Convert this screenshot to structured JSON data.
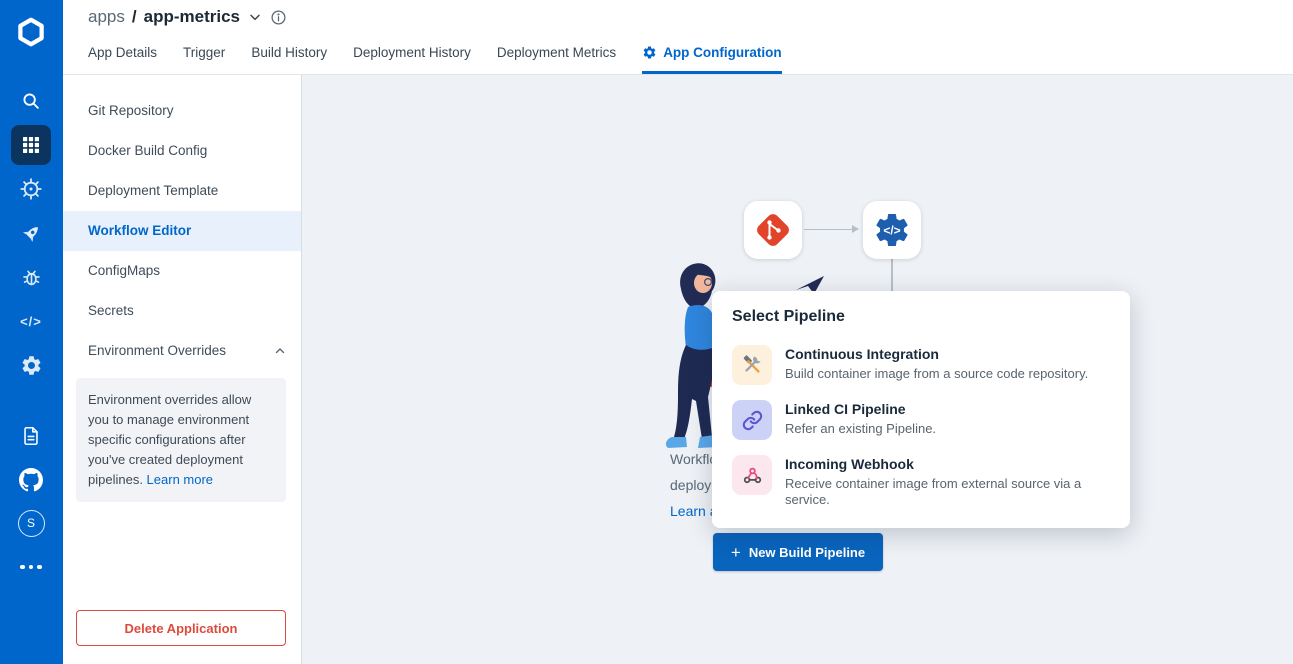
{
  "colors": {
    "accent": "#0066cc",
    "sidebar_bg": "#0066cc",
    "active_icon_bg": "#0b355e",
    "danger": "#dd4b3d",
    "link": "#0066cc",
    "ci_icon_bg": "#fdf0dc",
    "linked_icon_bg": "#ccd2f5",
    "webhook_icon_bg": "#fde7ee",
    "git_node_red": "#e2432b",
    "gear_node_blue": "#1d5fae"
  },
  "sidebar": {
    "icons": [
      {
        "name": "search"
      },
      {
        "name": "applications",
        "active": true
      },
      {
        "name": "helm-charts"
      },
      {
        "name": "deployment-groups"
      },
      {
        "name": "security"
      },
      {
        "name": "code"
      },
      {
        "name": "global-config"
      }
    ],
    "bottom_icons": [
      {
        "name": "documentation"
      },
      {
        "name": "github"
      },
      {
        "name": "profile",
        "label": "S"
      },
      {
        "name": "more"
      }
    ],
    "avatar_label": "S"
  },
  "header": {
    "breadcrumb": {
      "section": "apps",
      "separator": "/",
      "current": "app-metrics"
    },
    "tabs": [
      {
        "label": "App Details"
      },
      {
        "label": "Trigger"
      },
      {
        "label": "Build History"
      },
      {
        "label": "Deployment History"
      },
      {
        "label": "Deployment Metrics"
      },
      {
        "label": "App Configuration",
        "active": true,
        "icon": "gear-icon"
      }
    ]
  },
  "config_nav": {
    "items": [
      {
        "label": "Git Repository"
      },
      {
        "label": "Docker Build Config"
      },
      {
        "label": "Deployment Template"
      },
      {
        "label": "Workflow Editor",
        "active": true
      },
      {
        "label": "ConfigMaps"
      },
      {
        "label": "Secrets"
      },
      {
        "label": "Environment Overrides",
        "expanded": true
      }
    ],
    "env_overrides_note": {
      "text": "Environment overrides allow you to manage environment specific configurations after you've created deployment pipelines. ",
      "link_label": "Learn more"
    },
    "delete_button_label": "Delete Application"
  },
  "workflow": {
    "nodes": [
      {
        "name": "git-source-node",
        "icon": "git-icon"
      },
      {
        "name": "ci-build-node",
        "icon": "gear-code-icon"
      }
    ],
    "caption_fragments": {
      "line1": "Workflo",
      "line2": "deployr",
      "line3": "Learn a"
    },
    "new_pipeline_button": {
      "plus": "+",
      "label": "New Build Pipeline"
    }
  },
  "pipeline_popup": {
    "title": "Select Pipeline",
    "options": [
      {
        "title": "Continuous Integration",
        "description": "Build container image from a source code repository.",
        "icon": "tools-icon",
        "icon_bg": "#fdf0dc"
      },
      {
        "title": "Linked CI Pipeline",
        "description": "Refer an existing Pipeline.",
        "icon": "link-icon",
        "icon_bg": "#ccd2f5"
      },
      {
        "title": "Incoming Webhook",
        "description": "Receive container image from external source via a service.",
        "icon": "webhook-icon",
        "icon_bg": "#fde7ee"
      }
    ]
  }
}
